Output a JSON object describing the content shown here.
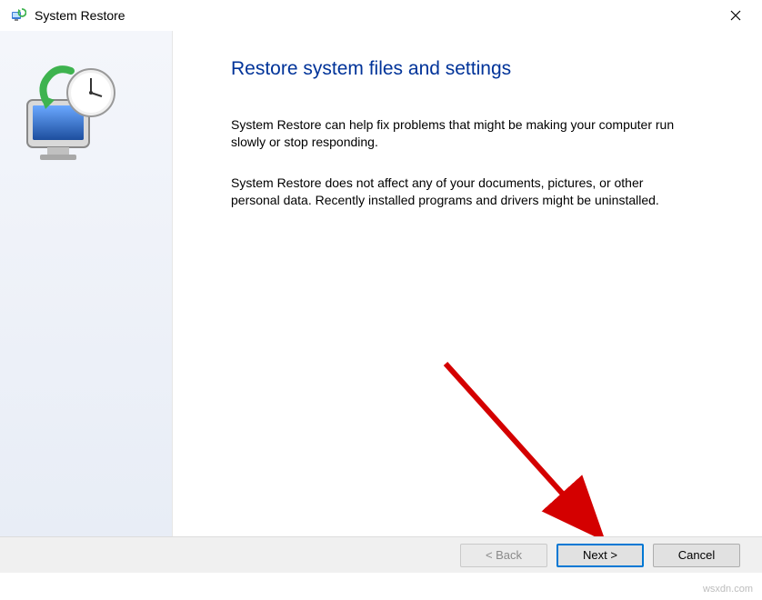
{
  "titlebar": {
    "title": "System Restore"
  },
  "main": {
    "heading": "Restore system files and settings",
    "para1": "System Restore can help fix problems that might be making your computer run slowly or stop responding.",
    "para2": "System Restore does not affect any of your documents, pictures, or other personal data. Recently installed programs and drivers might be uninstalled."
  },
  "buttons": {
    "back": "< Back",
    "next": "Next >",
    "cancel": "Cancel"
  },
  "watermark": "wsxdn.com"
}
